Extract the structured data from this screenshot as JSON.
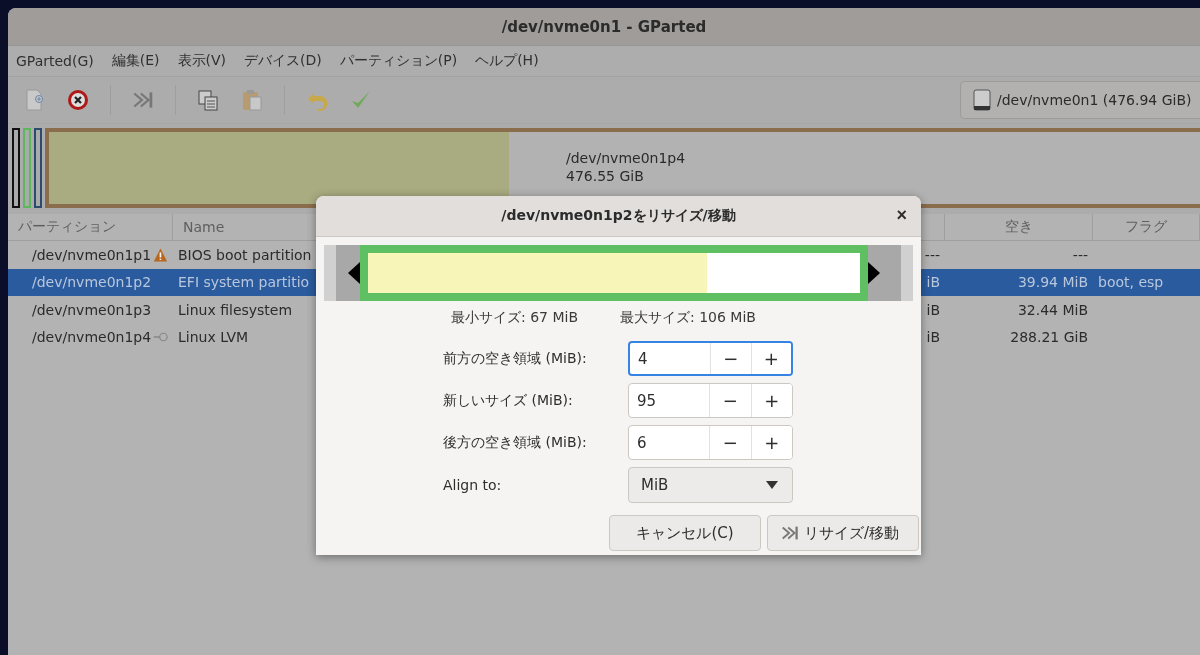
{
  "window": {
    "title": "/dev/nvme0n1 - GParted"
  },
  "menu": [
    "GParted(G)",
    "編集(E)",
    "表示(V)",
    "デバイス(D)",
    "パーティション(P)",
    "ヘルプ(H)"
  ],
  "toolbar": [
    {
      "kind": "new"
    },
    {
      "kind": "delete"
    },
    {
      "kind": "sep"
    },
    {
      "kind": "resize"
    },
    {
      "kind": "sep"
    },
    {
      "kind": "copy"
    },
    {
      "kind": "paste"
    },
    {
      "kind": "sep"
    },
    {
      "kind": "undo"
    },
    {
      "kind": "apply"
    }
  ],
  "device_selector": {
    "label": "/dev/nvme0n1 (476.94 GiB)"
  },
  "disk_map": {
    "slivers": [
      {
        "color": "#111111"
      },
      {
        "color": "#5cb85c"
      },
      {
        "color": "#2c4a6e"
      }
    ],
    "main": {
      "name": "/dev/nvme0n1p4",
      "size": "476.55 GiB",
      "level": 0.4
    }
  },
  "table": {
    "headers": [
      "パーティション",
      "Name",
      "空き",
      "フラグ"
    ],
    "rows": [
      {
        "partition": "/dev/nvme0n1p1",
        "kind": "warning",
        "name": "BIOS boot partition",
        "column_5": "---",
        "free": "---",
        "selected": false
      },
      {
        "partition": "/dev/nvme0n1p2",
        "name": "EFI system partitio",
        "column_5": "iB",
        "free": "39.94 MiB",
        "flags": "boot, esp",
        "selected": true
      },
      {
        "partition": "/dev/nvme0n1p3",
        "name": "Linux filesystem",
        "column_5": "iB",
        "free": "32.44 MiB",
        "selected": false
      },
      {
        "partition": "/dev/nvme0n1p4",
        "kind": "key",
        "name": "Linux LVM",
        "column_5": "iB",
        "free": "288.21 GiB",
        "selected": false
      }
    ]
  },
  "dialog": {
    "title": "/dev/nvme0n1p2をリサイズ/移動",
    "close": "×",
    "graphic": {
      "level": 0.69
    },
    "min_size": "最小サイズ: 67 MiB",
    "max_size": "最大サイズ: 106 MiB",
    "spins": [
      {
        "label": "前方の空き領域 (MiB):",
        "value": "4",
        "minus": "−",
        "plus": "+",
        "focused": true
      },
      {
        "label": "新しいサイズ (MiB):",
        "value": "95",
        "minus": "−",
        "plus": "+",
        "focused": false
      },
      {
        "label": "後方の空き領域 (MiB):",
        "value": "6",
        "minus": "−",
        "plus": "+",
        "focused": false
      }
    ],
    "align": {
      "label": "Align to:",
      "value": "MiB"
    },
    "buttons": [
      {
        "label": "キャンセル(C)",
        "kind": "plain"
      },
      {
        "label": "リサイズ/移動",
        "kind": "resize"
      }
    ]
  }
}
